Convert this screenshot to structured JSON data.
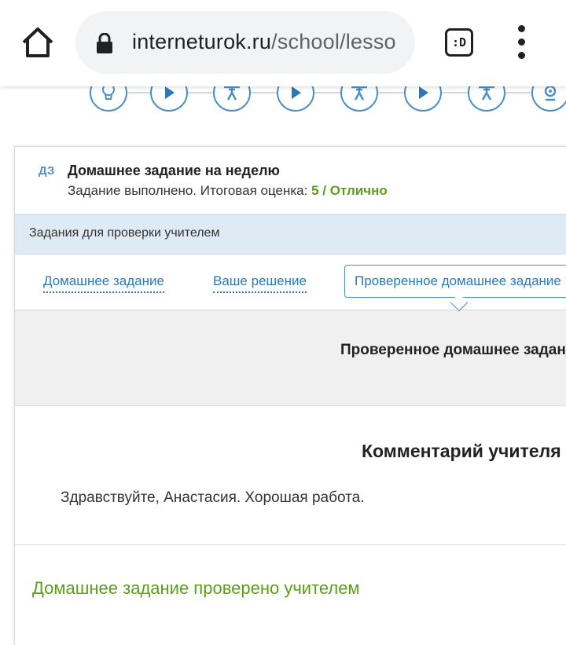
{
  "browser": {
    "url_domain": "interneturok.ru",
    "url_path": "/school/lesso",
    "tab_switcher_label": ":D",
    "icons": {
      "home": "home-icon",
      "lock": "lock-icon",
      "menu": "more-vert-icon"
    }
  },
  "steps": {
    "icons": [
      "lightbulb-icon",
      "play-icon",
      "trainer-icon",
      "play-icon",
      "trainer-icon",
      "play-icon",
      "trainer-icon",
      "webcam-icon"
    ],
    "accent_color": "#4a90c2"
  },
  "homework": {
    "badge": "ДЗ",
    "title": "Домашнее задание на неделю",
    "status_prefix": "Задание выполнено. Итоговая оценка: ",
    "grade": "5 / Отлично",
    "grade_color": "#5a9e1a"
  },
  "tasks_bar": {
    "label": "Задания для проверки учителем"
  },
  "tabs": {
    "homework": "Домашнее задание",
    "solution": "Ваше решение",
    "checked": "Проверенное домашнее задание"
  },
  "checked_section": {
    "title": "Проверенное домашнее задани"
  },
  "comment": {
    "title": "Комментарий учителя",
    "text": "Здравствуйте, Анастасия. Хорошая работа."
  },
  "footer_note": "Домашнее задание проверено учителем"
}
